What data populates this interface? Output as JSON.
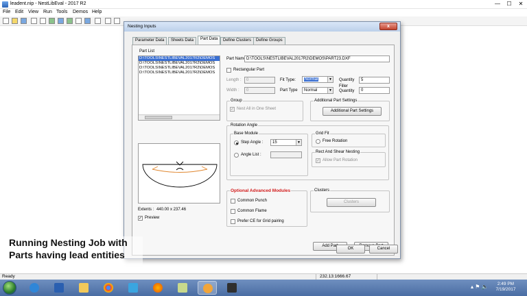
{
  "window": {
    "title": "leadent.nip - NestLibEval - 2017 R2",
    "min": "—",
    "max": "☐",
    "close": "✕"
  },
  "menu": [
    "File",
    "Edit",
    "View",
    "Run",
    "Tools",
    "Demos",
    "Help"
  ],
  "dialog": {
    "title": "Nesting Inputs",
    "close": "x",
    "tabs": [
      "Parameter Data",
      "Sheets Data",
      "Part Data",
      "Define Clusters",
      "Define Groups"
    ],
    "active_tab": "Part Data",
    "part_list": {
      "label": "Part List",
      "items": [
        "D:\\TOOLS\\NESTLIBEVAL2017R2\\DEMOS",
        "D:\\TOOLS\\NESTLIBEVAL2017R2\\DEMOS",
        "D:\\TOOLS\\NESTLIBEVAL2017R2\\DEMOS",
        "D:\\TOOLS\\NESTLIBEVAL2017R2\\DEMOS"
      ]
    },
    "extents": {
      "label": "Extents :",
      "value": "440.00 x 237.46"
    },
    "preview_label": "Preview",
    "part_name_label": "Part Name",
    "part_name_value": "D:\\TOOLS\\NESTLIBEVAL2017R2\\DEMOS\\PART23.DXF",
    "rectangular_part": "Rectangular Part",
    "length_label": "Length :",
    "length_value": "0",
    "width_label": "Width :",
    "width_value": "0",
    "fit_type_label": "Fit Type:",
    "fit_type_value": "Normal",
    "part_type_label": "Part Type",
    "part_type_value": "Normal",
    "quantity_label": "Quantity",
    "quantity_value": "5",
    "filler_quantity_label_1": "Filler",
    "filler_quantity_label_2": "Quantity",
    "filler_quantity_value": "0",
    "group": {
      "title": "Group",
      "nest_all": "Nest All in One Sheet"
    },
    "additional": {
      "title": "Additional Part Settings",
      "button": "Additional Part Settings"
    },
    "rotation": {
      "title": "Rotation Angle",
      "base_module": "Base Module",
      "step_angle_label": "Step Angle :",
      "step_angle_value": "15",
      "angle_list_label": "Angle List :"
    },
    "grid_fit": {
      "title": "Grid Fit",
      "free_rotation": "Free Rotation"
    },
    "rect_shear": {
      "title": "Rect And Shear Nesting",
      "allow_rotation": "Allow Part Rotation"
    },
    "advanced": {
      "title": "Optional Advanced Modules",
      "common_punch": "Common Punch",
      "common_flame": "Common Flame",
      "prefer_ce": "Prefer CE for Grid pairing"
    },
    "clusters": {
      "title": "Clusters",
      "button": "Clusters"
    },
    "add_part": "Add Part",
    "remove_part": "Remove Part",
    "ok": "OK",
    "cancel": "Cancel"
  },
  "status": {
    "ready": "Ready",
    "coords": "232.13:1666.67"
  },
  "caption": {
    "line1": "Running Nesting Job with",
    "line2": "Parts having lead entities"
  },
  "taskbar": {
    "time": "2:49 PM",
    "date": "7/19/2017"
  },
  "colors": {
    "accent": "#3a6fd2",
    "advanced_title": "#d21b1b",
    "taskbar": "#5479b0"
  }
}
